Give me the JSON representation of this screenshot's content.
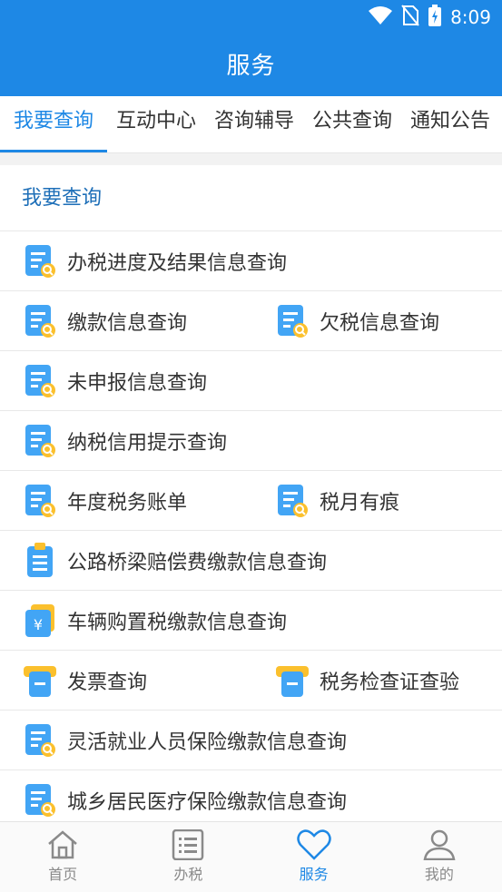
{
  "status_bar": {
    "time": "8:09"
  },
  "header": {
    "title": "服务"
  },
  "tabs": [
    {
      "label": "我要查询",
      "active": true
    },
    {
      "label": "互动中心",
      "active": false
    },
    {
      "label": "咨询辅导",
      "active": false
    },
    {
      "label": "公共查询",
      "active": false
    },
    {
      "label": "通知公告",
      "active": false
    }
  ],
  "section": {
    "title": "我要查询"
  },
  "items": [
    {
      "label": "办税进度及结果信息查询",
      "icon": "doc-search-icon"
    },
    {
      "label": "缴款信息查询",
      "icon": "doc-search-icon"
    },
    {
      "label": "欠税信息查询",
      "icon": "doc-search-icon"
    },
    {
      "label": "未申报信息查询",
      "icon": "doc-search-icon"
    },
    {
      "label": "纳税信用提示查询",
      "icon": "doc-search-icon"
    },
    {
      "label": "年度税务账单",
      "icon": "doc-search-icon"
    },
    {
      "label": "税月有痕",
      "icon": "doc-search-icon"
    },
    {
      "label": "公路桥梁赔偿费缴款信息查询",
      "icon": "clipboard-icon"
    },
    {
      "label": "车辆购置税缴款信息查询",
      "icon": "yuan-card-icon"
    },
    {
      "label": "发票查询",
      "icon": "invoice-icon"
    },
    {
      "label": "税务检查证查验",
      "icon": "invoice-icon"
    },
    {
      "label": "灵活就业人员保险缴款信息查询",
      "icon": "doc-search-icon"
    },
    {
      "label": "城乡居民医疗保险缴款信息查询",
      "icon": "doc-search-icon"
    }
  ],
  "bottom_nav": [
    {
      "label": "首页",
      "icon": "home-icon",
      "active": false
    },
    {
      "label": "办税",
      "icon": "list-icon",
      "active": false
    },
    {
      "label": "服务",
      "icon": "heart-icon",
      "active": true
    },
    {
      "label": "我的",
      "icon": "user-icon",
      "active": false
    }
  ],
  "colors": {
    "primary": "#1e88e5",
    "icon_blue": "#42a5f5",
    "icon_yellow": "#fbc02d"
  }
}
